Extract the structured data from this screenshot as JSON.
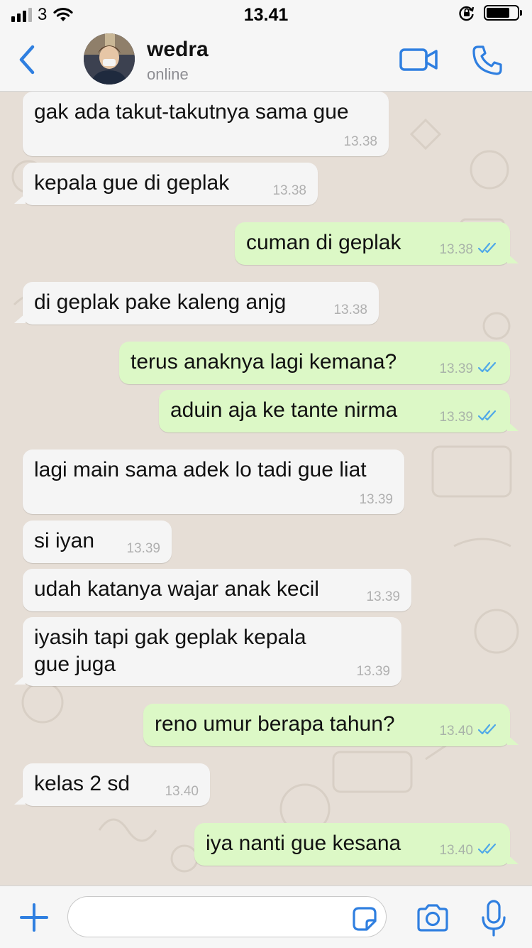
{
  "status_bar": {
    "carrier": "3",
    "time": "13.41",
    "battery_level": 0.75,
    "icons": [
      "signal-icon",
      "wifi-icon",
      "orientation-lock-icon",
      "battery-icon"
    ]
  },
  "header": {
    "contact_name": "wedra",
    "contact_status": "online",
    "icons": [
      "back-icon",
      "avatar",
      "video-call-icon",
      "phone-call-icon"
    ]
  },
  "messages": [
    {
      "dir": "in",
      "text": "gak ada takut-takutnya sama gue",
      "time": "13.38",
      "read": false
    },
    {
      "dir": "in",
      "text": "kepala gue di geplak",
      "time": "13.38",
      "read": false
    },
    {
      "dir": "out",
      "text": "cuman di geplak",
      "time": "13.38",
      "read": true
    },
    {
      "dir": "in",
      "text": "di geplak pake kaleng anjg",
      "time": "13.38",
      "read": false
    },
    {
      "dir": "out",
      "text": "terus anaknya lagi kemana?",
      "time": "13.39",
      "read": true
    },
    {
      "dir": "out",
      "text": "aduin aja ke tante nirma",
      "time": "13.39",
      "read": true
    },
    {
      "dir": "in",
      "text": "lagi main sama adek lo tadi gue liat",
      "time": "13.39",
      "read": false
    },
    {
      "dir": "in",
      "text": "si iyan",
      "time": "13.39",
      "read": false
    },
    {
      "dir": "in",
      "text": "udah katanya wajar anak kecil",
      "time": "13.39",
      "read": false
    },
    {
      "dir": "in",
      "text": "iyasih tapi gak geplak kepala gue juga",
      "time": "13.39",
      "read": false
    },
    {
      "dir": "out",
      "text": "reno umur berapa tahun?",
      "time": "13.40",
      "read": true
    },
    {
      "dir": "in",
      "text": "kelas 2 sd",
      "time": "13.40",
      "read": false
    },
    {
      "dir": "out",
      "text": "iya nanti gue kesana",
      "time": "13.40",
      "read": true
    }
  ],
  "composer": {
    "value": "",
    "icons": [
      "plus-icon",
      "sticker-icon",
      "camera-icon",
      "microphone-icon"
    ]
  },
  "colors": {
    "accent": "#2f7fe0",
    "chat_background": "#e6ded6",
    "incoming_bubble": "#f5f5f5",
    "outgoing_bubble": "#dcf8c6",
    "read_ticks": "#4fa8e8"
  }
}
